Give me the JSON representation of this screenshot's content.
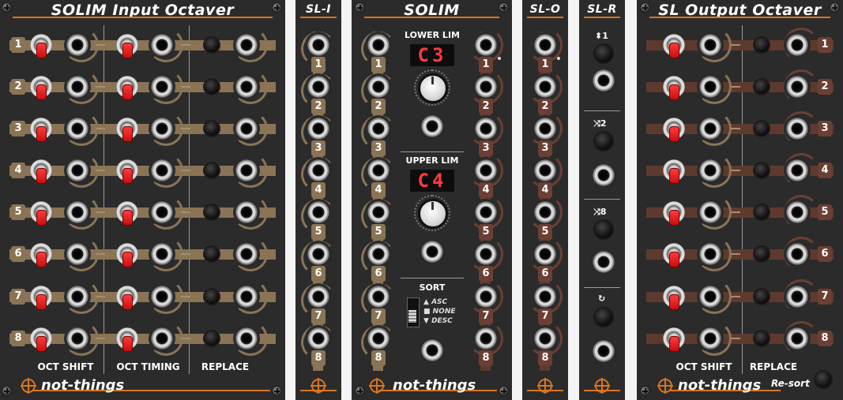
{
  "colors": {
    "accent": "#d9761e",
    "tan": "#8a7455",
    "brown": "#6b3f33",
    "panel": "#2b2b2b"
  },
  "module1": {
    "title": "SOLIM Input Octaver",
    "rows": [
      "1",
      "2",
      "3",
      "4",
      "5",
      "6",
      "7",
      "8"
    ],
    "labels": {
      "oct_shift": "OCT SHIFT",
      "oct_timing": "OCT TIMING",
      "replace": "REPLACE"
    },
    "brand": "not-things"
  },
  "module2": {
    "title": "SL-I",
    "rows": [
      "1",
      "2",
      "3",
      "4",
      "5",
      "6",
      "7",
      "8"
    ]
  },
  "module3": {
    "title": "SOLIM",
    "lower_lim_label": "LOWER LIM",
    "lower_lim_value": "C3",
    "upper_lim_label": "UPPER LIM",
    "upper_lim_value": "C4",
    "sort_label": "SORT",
    "sort_options": {
      "asc": "ASC",
      "none": "NONE",
      "desc": "DESC"
    },
    "rows": [
      "1",
      "2",
      "3",
      "4",
      "5",
      "6",
      "7",
      "8"
    ],
    "brand": "not-things"
  },
  "module4": {
    "title": "SL-O",
    "rows": [
      "1",
      "2",
      "3",
      "4",
      "5",
      "6",
      "7",
      "8"
    ]
  },
  "module5": {
    "title": "SL-R",
    "btn1_label": "1",
    "btn2_label": "2",
    "btn3_label": "8",
    "icons": [
      "sort-arrows-icon",
      "shuffle-icon",
      "shuffle-icon",
      "reset-icon"
    ]
  },
  "module6": {
    "title": "SL Output Octaver",
    "rows": [
      "1",
      "2",
      "3",
      "4",
      "5",
      "6",
      "7",
      "8"
    ],
    "labels": {
      "oct_shift": "OCT SHIFT",
      "replace": "REPLACE"
    },
    "resort": "Re-sort",
    "brand": "not-things"
  }
}
